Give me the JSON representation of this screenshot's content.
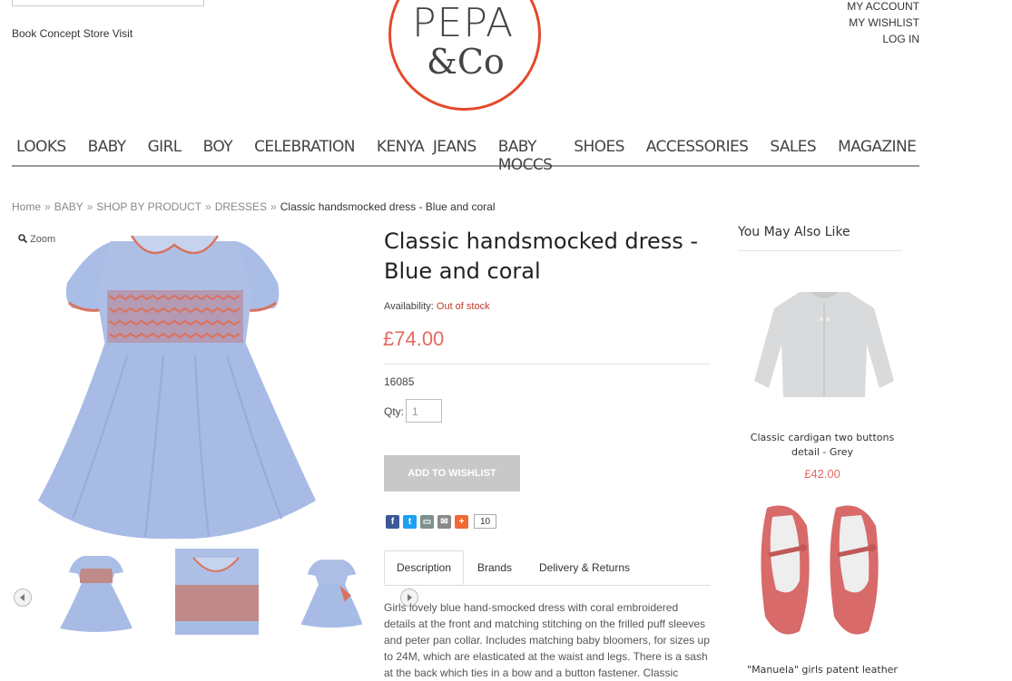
{
  "header": {
    "store_link": "Book Concept Store Visit",
    "logo_line1": "PEPA",
    "logo_line2": "&Co",
    "account_links": [
      "MY ACCOUNT",
      "MY WISHLIST",
      "LOG IN"
    ]
  },
  "nav": [
    "LOOKS",
    "BABY",
    "GIRL",
    "BOY",
    "CELEBRATION",
    "KENYA  JEANS",
    "BABY MOCCS",
    "SHOES",
    "ACCESSORIES",
    "SALES",
    "MAGAZINE"
  ],
  "breadcrumb": {
    "items": [
      "Home",
      "BABY",
      "SHOP BY PRODUCT",
      "DRESSES"
    ],
    "current": "Classic handsmocked dress - Blue and coral",
    "separator": "»"
  },
  "gallery": {
    "zoom_label": "Zoom"
  },
  "product": {
    "title": "Classic handsmocked dress - Blue and coral",
    "availability_label": "Availability:",
    "availability_value": "Out of stock",
    "price": "£74.00",
    "sku": "16085",
    "qty_label": "Qty:",
    "qty_value": "1",
    "wishlist_button": "ADD TO WISHLIST",
    "share_count": "10"
  },
  "tabs": [
    "Description",
    "Brands",
    "Delivery & Returns"
  ],
  "description": "Girls lovely blue hand-smocked dress with coral embroidered details at the front and matching stitching on the frilled puff sleeves and peter pan collar. Includes matching baby bloomers, for sizes up to 24M, which are elasticated at the waist and legs. There is a sash at the back which ties in a bow and a button fastener. Classic",
  "sidebar": {
    "heading": "You May Also Like",
    "products": [
      {
        "name": "Classic cardigan two buttons detail - Grey",
        "price": "£42.00"
      },
      {
        "name": "\"Manuela\" girls patent leather",
        "price": ""
      }
    ]
  },
  "colors": {
    "accent": "#e4492a",
    "price": "#e46a5f",
    "out_of_stock": "#c0392b",
    "dress_blue": "#a9bde6",
    "coral": "#d9735e",
    "facebook": "#3b5998",
    "twitter": "#1da1f2"
  },
  "icons": [
    "search-icon",
    "arrow-left-icon",
    "arrow-right-icon",
    "facebook-icon",
    "twitter-icon",
    "print-icon",
    "email-icon",
    "plus-icon"
  ]
}
